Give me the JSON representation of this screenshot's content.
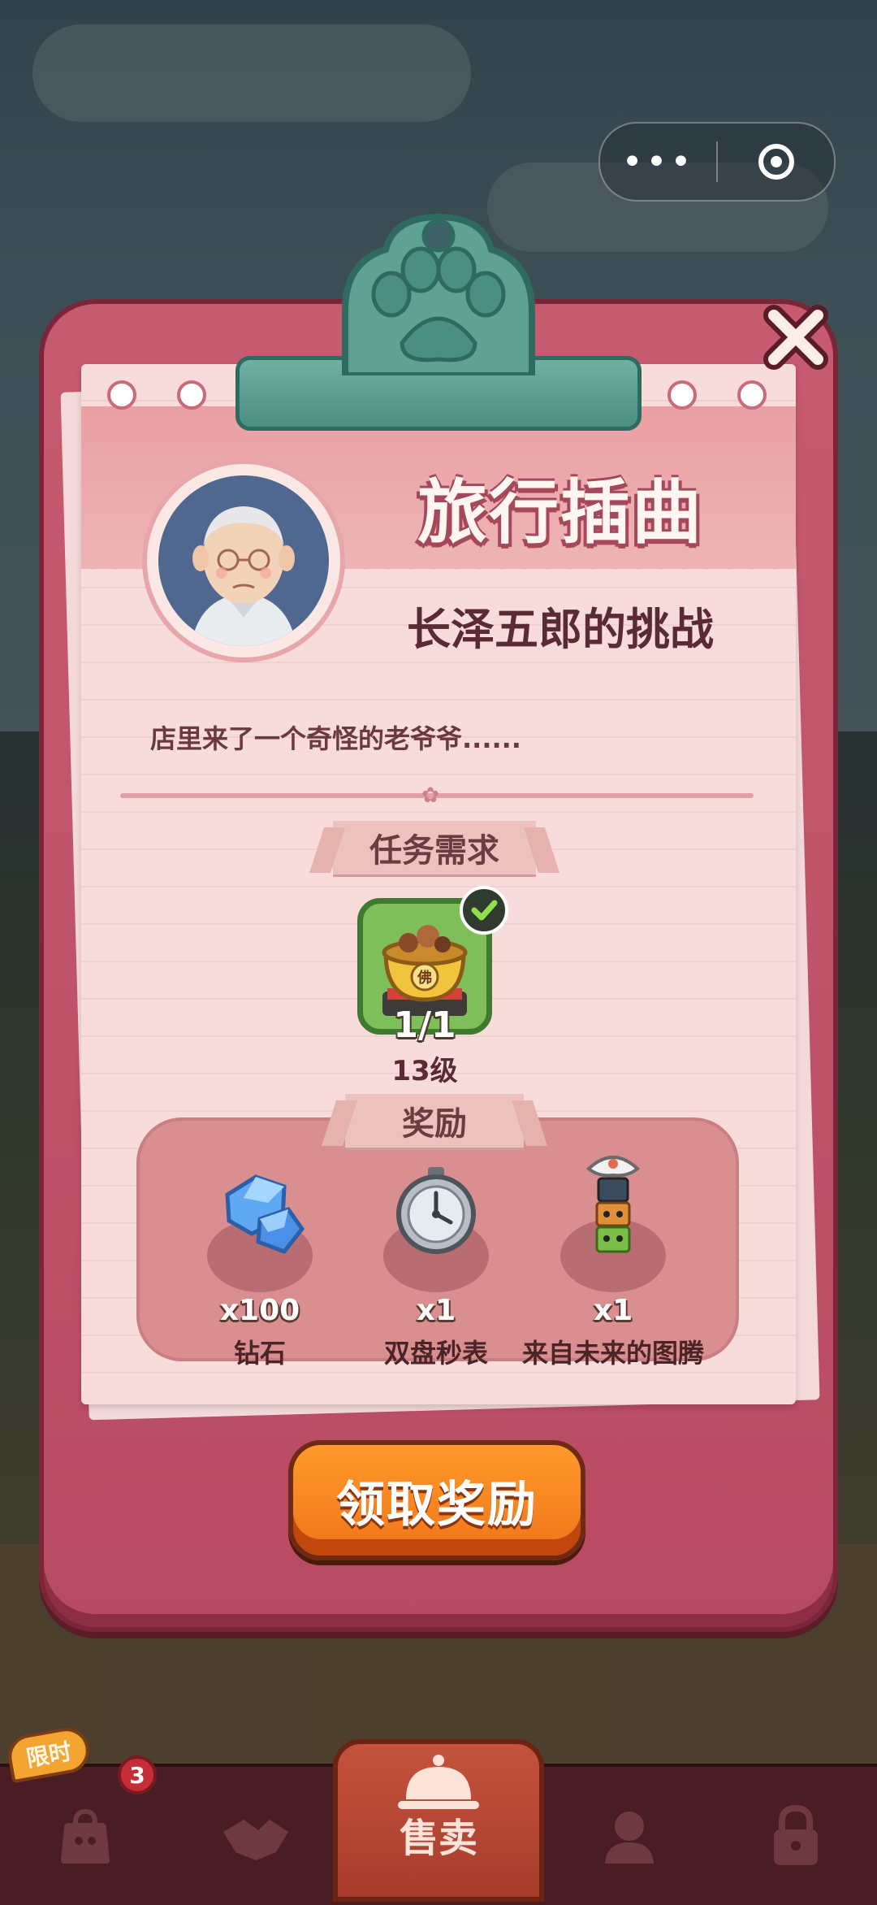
{
  "capsule": {
    "more_glyph": "•••"
  },
  "event": {
    "title": "旅行插曲",
    "subtitle": "长泽五郎的挑战",
    "description": "店里来了一个奇怪的老爷爷......"
  },
  "task": {
    "header": "任务需求",
    "item_icon": "buddha-pot-dish",
    "item_label": "佛",
    "progress_text": "1/1",
    "level_text": "13级",
    "completed": true
  },
  "rewards": {
    "header": "奖励",
    "items": [
      {
        "icon": "diamond-icon",
        "qty": "x100",
        "name": "钻石"
      },
      {
        "icon": "stopwatch-icon",
        "qty": "x1",
        "name": "双盘秒表"
      },
      {
        "icon": "totem-icon",
        "qty": "x1",
        "name": "来自未来的图腾"
      }
    ]
  },
  "claim_button": {
    "label": "领取奖励"
  },
  "bottom_nav": {
    "limited_tag": "限时",
    "badge_count": "3",
    "sell_label": "售卖"
  },
  "colors": {
    "board": "#c65b70",
    "paper": "#f7dcdb",
    "clip": "#5fa294",
    "claim": "#f5821f"
  }
}
